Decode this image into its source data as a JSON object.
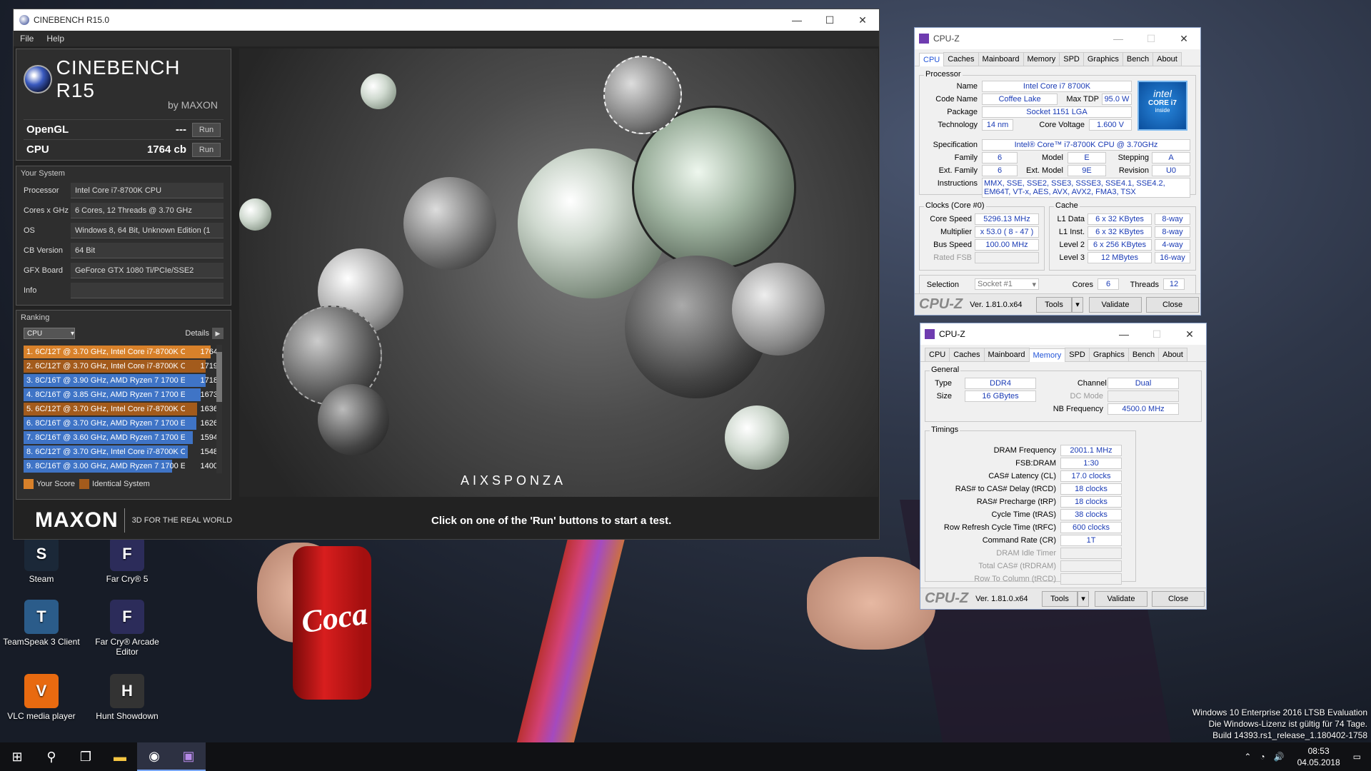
{
  "desktop_icons": [
    {
      "label": "Steam",
      "icon": "steam-icon",
      "color": "#1b2838"
    },
    {
      "label": "Far Cry® 5",
      "icon": "farcry5-icon",
      "color": "#2c2c5a"
    },
    {
      "label": "TeamSpeak 3 Client",
      "icon": "teamspeak-icon",
      "color": "#2b5c8a"
    },
    {
      "label": "Far Cry® Arcade Editor",
      "icon": "farcry5-editor-icon",
      "color": "#2c2c5a"
    },
    {
      "label": "VLC media player",
      "icon": "vlc-icon",
      "color": "#e86a10"
    },
    {
      "label": "Hunt Showdown",
      "icon": "hunt-icon",
      "color": "#333"
    }
  ],
  "windows_notice": {
    "line1": "Windows 10 Enterprise 2016 LTSB Evaluation",
    "line2": "Die Windows-Lizenz ist gültig für 74 Tage.",
    "line3": "Build 14393.rs1_release_1.180402-1758"
  },
  "taskbar": {
    "time": "08:53",
    "date": "04.05.2018"
  },
  "cinebench": {
    "title": "CINEBENCH R15.0",
    "menu": [
      "File",
      "Help"
    ],
    "logo_name": "CINEBENCH R15",
    "logo_by": "by MAXON",
    "opengl_label": "OpenGL",
    "opengl_value": "---",
    "cpu_label": "CPU",
    "cpu_value": "1764 cb",
    "run_label": "Run",
    "your_system_label": "Your System",
    "system": [
      {
        "k": "Processor",
        "v": "Intel Core i7-8700K CPU"
      },
      {
        "k": "Cores x GHz",
        "v": "6 Cores, 12 Threads @ 3.70 GHz"
      },
      {
        "k": "OS",
        "v": "Windows 8, 64 Bit, Unknown Edition (1"
      },
      {
        "k": "CB Version",
        "v": "64 Bit"
      },
      {
        "k": "GFX Board",
        "v": "GeForce GTX 1080 Ti/PCIe/SSE2"
      },
      {
        "k": "Info",
        "v": ""
      }
    ],
    "ranking_label": "Ranking",
    "ranking_select": "CPU",
    "details_label": "Details",
    "ranking": [
      {
        "t": "1. 6C/12T @ 3.70 GHz, Intel Core i7-8700K C",
        "s": "1764",
        "kind": "own"
      },
      {
        "t": "2. 6C/12T @ 3.70 GHz, Intel Core i7-8700K C",
        "s": "1719",
        "kind": "ident"
      },
      {
        "t": "3. 8C/16T @ 3.90 GHz, AMD Ryzen 7 1700 E",
        "s": "1718",
        "kind": "other"
      },
      {
        "t": "4. 8C/16T @ 3.85 GHz, AMD Ryzen 7 1700 E",
        "s": "1673",
        "kind": "other"
      },
      {
        "t": "5. 6C/12T @ 3.70 GHz, Intel Core i7-8700K C",
        "s": "1636",
        "kind": "ident"
      },
      {
        "t": "6. 8C/16T @ 3.70 GHz, AMD Ryzen 7 1700 E",
        "s": "1626",
        "kind": "other"
      },
      {
        "t": "7. 8C/16T @ 3.60 GHz, AMD Ryzen 7 1700 E",
        "s": "1594",
        "kind": "other"
      },
      {
        "t": "8. 6C/12T @ 3.70 GHz, Intel Core i7-8700K C",
        "s": "1548",
        "kind": "other"
      },
      {
        "t": "9. 8C/16T @ 3.00 GHz, AMD Ryzen 7 1700 E",
        "s": "1400",
        "kind": "other"
      }
    ],
    "legend_your": "Your Score",
    "legend_ident": "Identical System",
    "colors": {
      "own": "#d8812a",
      "ident": "#a35b1c",
      "other": "#3f74c6"
    },
    "render_watermark": "AIXSPONZA",
    "maxon": "MAXON",
    "tagline": "3D FOR THE REAL WORLD",
    "footer_msg": "Click on one of the 'Run' buttons to start a test."
  },
  "cpuz1": {
    "title": "CPU-Z",
    "tabs": [
      "CPU",
      "Caches",
      "Mainboard",
      "Memory",
      "SPD",
      "Graphics",
      "Bench",
      "About"
    ],
    "selected_tab": "CPU",
    "processor_label": "Processor",
    "name_l": "Name",
    "name": "Intel Core i7 8700K",
    "code_l": "Code Name",
    "code": "Coffee Lake",
    "tdp_l": "Max TDP",
    "tdp": "95.0 W",
    "pkg_l": "Package",
    "pkg": "Socket 1151 LGA",
    "tech_l": "Technology",
    "tech": "14 nm",
    "cv_l": "Core Voltage",
    "cv": "1.600 V",
    "spec_l": "Specification",
    "spec": "Intel® Core™ i7-8700K CPU @ 3.70GHz",
    "fam_l": "Family",
    "fam": "6",
    "model_l": "Model",
    "model": "E",
    "step_l": "Stepping",
    "step": "A",
    "extfam_l": "Ext. Family",
    "extfam": "6",
    "extmodel_l": "Ext. Model",
    "extmodel": "9E",
    "rev_l": "Revision",
    "rev": "U0",
    "instr_l": "Instructions",
    "instr": "MMX, SSE, SSE2, SSE3, SSSE3, SSE4.1, SSE4.2, EM64T, VT-x, AES, AVX, AVX2, FMA3, TSX",
    "clocks_label": "Clocks (Core #0)",
    "cs_l": "Core Speed",
    "cs": "5296.13 MHz",
    "mul_l": "Multiplier",
    "mul": "x 53.0 ( 8 - 47 )",
    "bus_l": "Bus Speed",
    "bus": "100.00 MHz",
    "fsb_l": "Rated FSB",
    "fsb": "",
    "cache_label": "Cache",
    "l1d_l": "L1 Data",
    "l1d": "6 x 32 KBytes",
    "l1d_w": "8-way",
    "l1i_l": "L1 Inst.",
    "l1i": "6 x 32 KBytes",
    "l1i_w": "8-way",
    "l2_l": "Level 2",
    "l2": "6 x 256 KBytes",
    "l2_w": "4-way",
    "l3_l": "Level 3",
    "l3": "12 MBytes",
    "l3_w": "16-way",
    "sel_l": "Selection",
    "sel": "Socket #1",
    "cores_l": "Cores",
    "cores": "6",
    "threads_l": "Threads",
    "threads": "12",
    "intel_brand": "intel",
    "intel_line": "CORE i7",
    "intel_sub": "inside",
    "logo": "CPU-Z",
    "ver": "Ver. 1.81.0.x64",
    "tools": "Tools",
    "validate": "Validate",
    "close": "Close"
  },
  "cpuz2": {
    "title": "CPU-Z",
    "tabs": [
      "CPU",
      "Caches",
      "Mainboard",
      "Memory",
      "SPD",
      "Graphics",
      "Bench",
      "About"
    ],
    "selected_tab": "Memory",
    "general_label": "General",
    "type_l": "Type",
    "type": "DDR4",
    "size_l": "Size",
    "size": "16 GBytes",
    "ch_l": "Channel #",
    "ch": "Dual",
    "dc_l": "DC Mode",
    "dc": "",
    "nb_l": "NB Frequency",
    "nb": "4500.0 MHz",
    "timings_label": "Timings",
    "timings": [
      {
        "k": "DRAM Frequency",
        "v": "2001.1 MHz",
        "g": false
      },
      {
        "k": "FSB:DRAM",
        "v": "1:30",
        "g": false
      },
      {
        "k": "CAS# Latency (CL)",
        "v": "17.0 clocks",
        "g": false
      },
      {
        "k": "RAS# to CAS# Delay (tRCD)",
        "v": "18 clocks",
        "g": false
      },
      {
        "k": "RAS# Precharge (tRP)",
        "v": "18 clocks",
        "g": false
      },
      {
        "k": "Cycle Time (tRAS)",
        "v": "38 clocks",
        "g": false
      },
      {
        "k": "Row Refresh Cycle Time (tRFC)",
        "v": "600 clocks",
        "g": false
      },
      {
        "k": "Command Rate (CR)",
        "v": "1T",
        "g": false
      },
      {
        "k": "DRAM Idle Timer",
        "v": "",
        "g": true
      },
      {
        "k": "Total CAS# (tRDRAM)",
        "v": "",
        "g": true
      },
      {
        "k": "Row To Column (tRCD)",
        "v": "",
        "g": true
      }
    ],
    "logo": "CPU-Z",
    "ver": "Ver. 1.81.0.x64",
    "tools": "Tools",
    "validate": "Validate",
    "close": "Close"
  }
}
